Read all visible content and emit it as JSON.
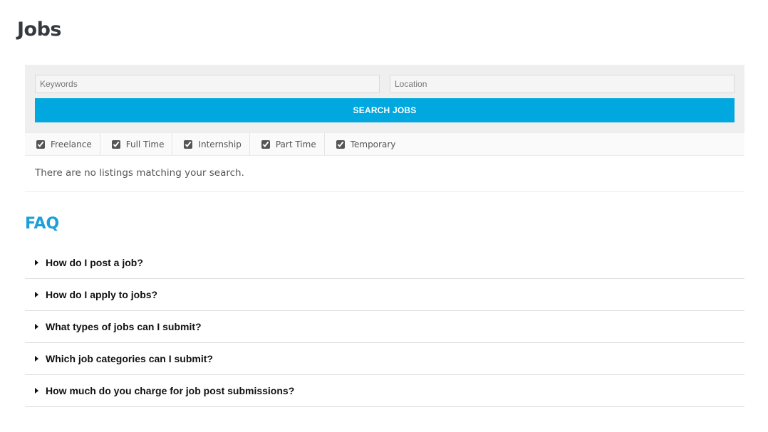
{
  "page": {
    "title": "Jobs"
  },
  "search": {
    "keywords_placeholder": "Keywords",
    "keywords_value": "",
    "location_placeholder": "Location",
    "location_value": "",
    "button_label": "SEARCH JOBS"
  },
  "job_types": [
    {
      "label": "Freelance",
      "checked": true
    },
    {
      "label": "Full Time",
      "checked": true
    },
    {
      "label": "Internship",
      "checked": true
    },
    {
      "label": "Part Time",
      "checked": true
    },
    {
      "label": "Temporary",
      "checked": true
    }
  ],
  "results": {
    "message": "There are no listings matching your search."
  },
  "faq": {
    "title": "FAQ",
    "items": [
      {
        "question": "How do I post a job?"
      },
      {
        "question": "How do I apply to jobs?"
      },
      {
        "question": "What types of jobs can I submit?"
      },
      {
        "question": "Which job categories can I submit?"
      },
      {
        "question": "How much do you charge for job post submissions?"
      }
    ]
  },
  "colors": {
    "accent": "#00a8df",
    "faq_title": "#1d9fd8",
    "heading": "#33393f",
    "panel_bg": "#efefef"
  },
  "icons": {
    "faq_toggle": "caret-right-icon"
  }
}
